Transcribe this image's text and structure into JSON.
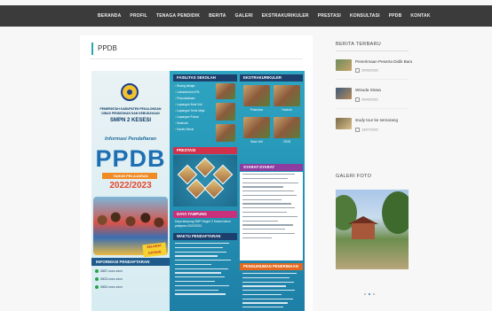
{
  "nav": {
    "items": [
      "BERANDA",
      "PROFIL",
      "TENAGA PENDIDIK",
      "BERITA",
      "GALERI",
      "EKSTRAKURIKULER",
      "PRESTASI",
      "KONSULTASI",
      "PPDB",
      "KONTAK"
    ]
  },
  "main": {
    "title": "PPDB",
    "accent_color": "#29a8b0"
  },
  "poster": {
    "gov": "PEMERINTAH KABUPATEN PEKALONGAN",
    "dinas": "DINAS PENDIDIKAN DAN KEBUDAYAAN",
    "school": "SMPN 2 KESESI",
    "info": "Informasi Pendaftaran",
    "ppdb": "PPDB",
    "tahun": "TAHUN PELAJARAN",
    "year": "2022/2023",
    "info_header": "INFORMASI PENDAFTARAN",
    "contacts": [
      "0857-xxxx-xxxx",
      "0823-xxxx-xxxx",
      "0852-xxxx-xxxx"
    ],
    "fasilitas_header": "FASILITAS SEKOLAH",
    "fasilitas": [
      "Ruang belajar",
      "Laboratorium IPA",
      "Perpustakaan",
      "Lapangan Bola Voli",
      "Lapangan Tenis Meja",
      "Lapangan Futsal",
      "Mushola",
      "Kantin Sehat"
    ],
    "ekstra_header": "EKSTRAKURIKULER",
    "ekstra": [
      "Pramuka",
      "Hadroh",
      "Bola Voli",
      "OSIS"
    ],
    "prestasi_header": "PRESTASI",
    "syarat_header": "SYARAT-SYARAT PENDAFTARAN",
    "daya_header": "DAYA TAMPUNG",
    "daya_text": "Daya tampung SMP Negeri 2 Kesesi tahun pelajaran 2022/2023",
    "waktu_header": "WAKTU PENDAFTARAN",
    "pengumuman_header": "PENGUMUMAN PENERIMAAN",
    "badge": "SELAMAT DATANG"
  },
  "sidebar": {
    "recent_title": "BERITA TERBARU",
    "news": [
      {
        "title": "Penerimaan Peserta Didik Baru",
        "date": "20/06/2022"
      },
      {
        "title": "Wisuda Siswa",
        "date": "20/06/2021"
      },
      {
        "title": "study tour ke semarang",
        "date": "13/07/2022"
      }
    ],
    "gallery_title": "GALERI FOTO"
  }
}
